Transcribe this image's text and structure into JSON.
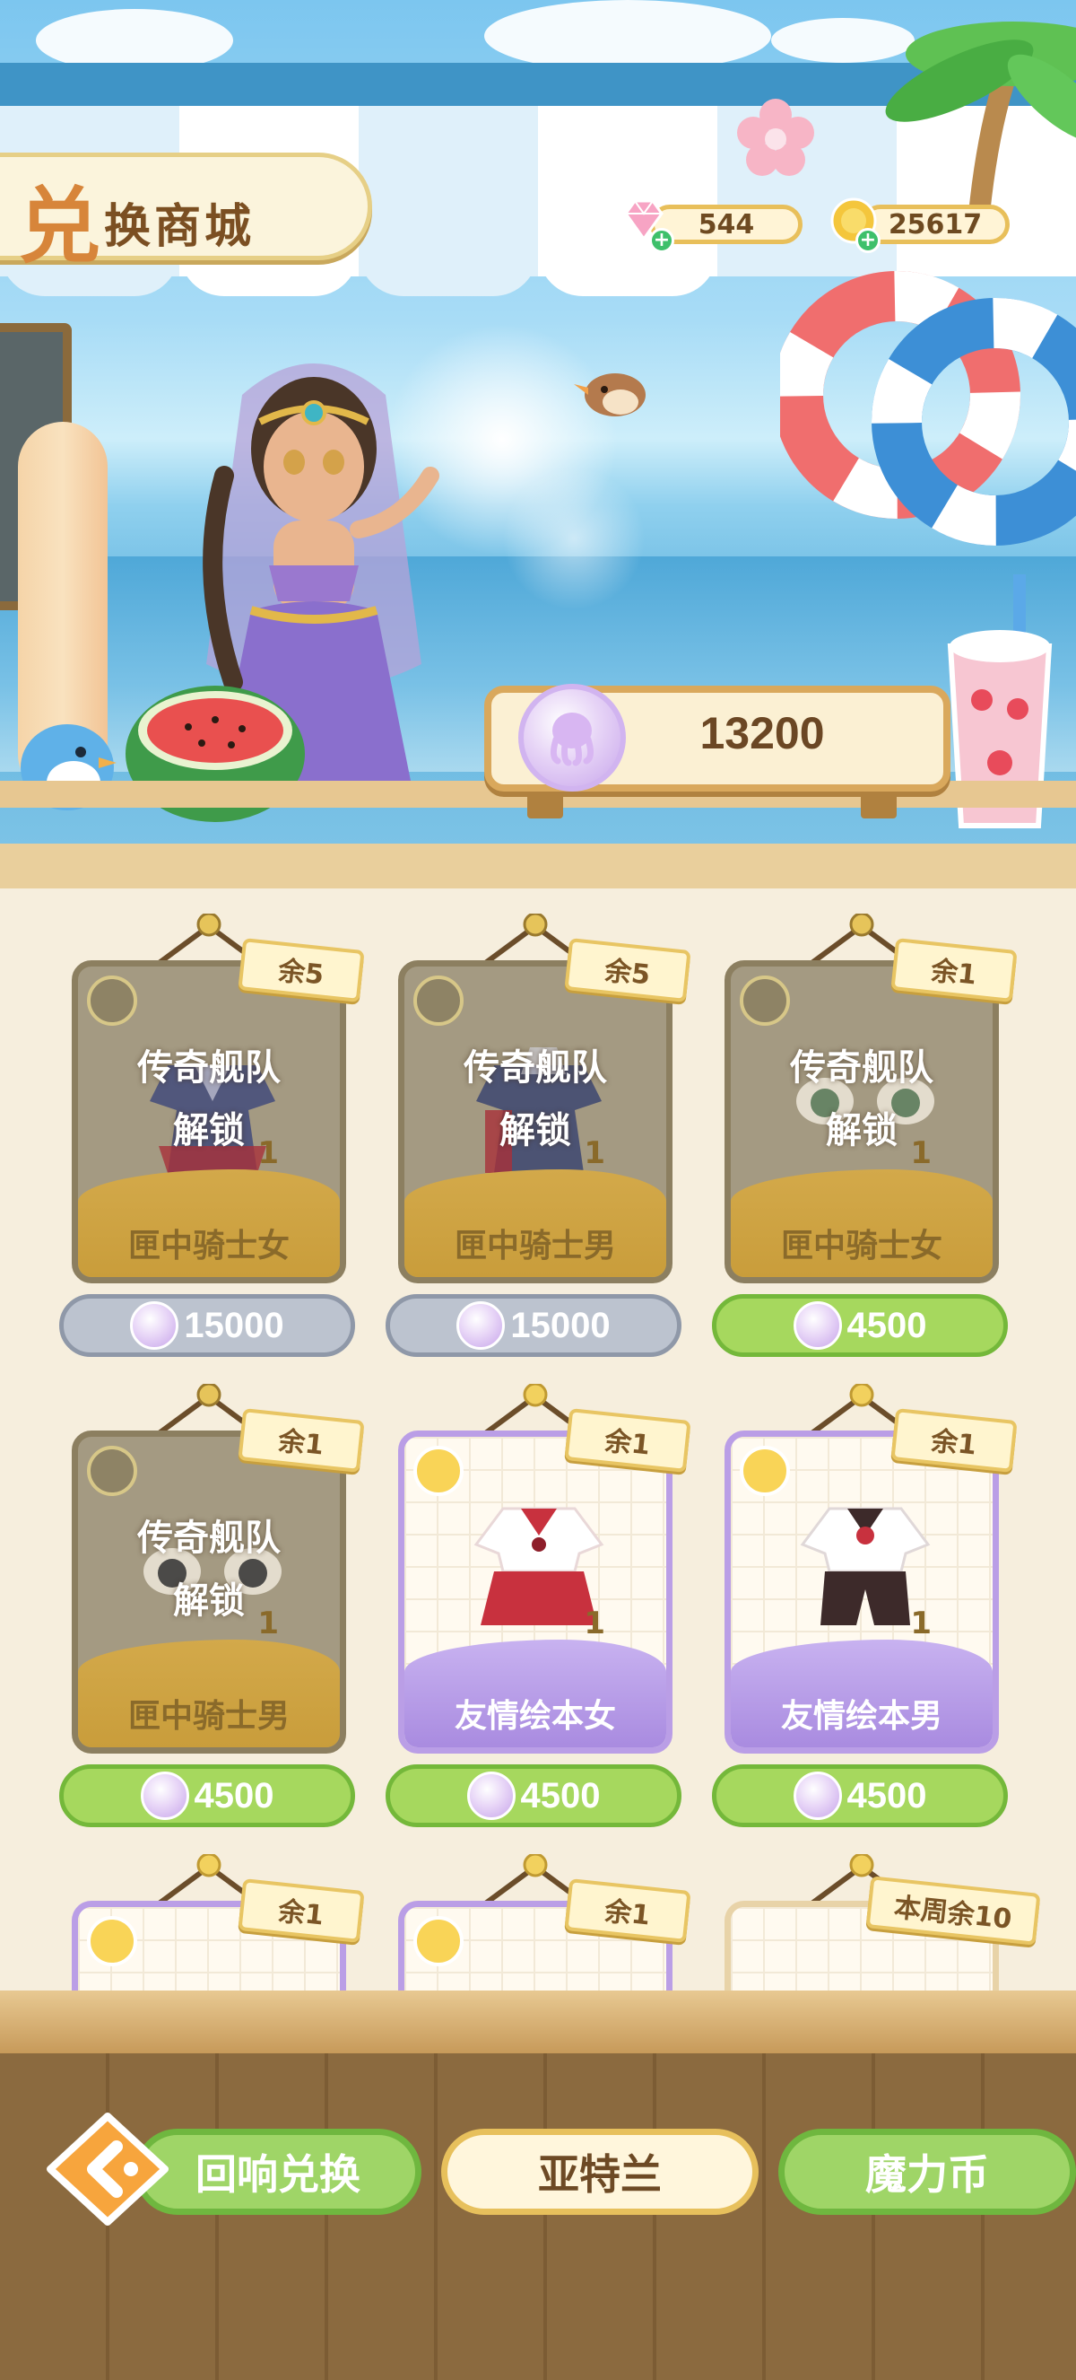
{
  "header": {
    "title_first_char": "兑",
    "title_rest": "换商城",
    "currency_gem": {
      "icon": "pink-diamond-icon",
      "value": "544"
    },
    "currency_gold": {
      "icon": "gold-coin-icon",
      "value": "25617"
    }
  },
  "balance": {
    "icon": "octopus-token-icon",
    "value": "13200"
  },
  "items": [
    {
      "stock": "余5",
      "locked": true,
      "lock_line1": "传奇舰队",
      "lock_line2": "解锁",
      "count": "1",
      "name": "匣中骑士女",
      "price": "15000",
      "price_style": "gray"
    },
    {
      "stock": "余5",
      "locked": true,
      "lock_line1": "传奇舰队",
      "lock_line2": "解锁",
      "count": "1",
      "name": "匣中骑士男",
      "price": "15000",
      "price_style": "gray"
    },
    {
      "stock": "余1",
      "locked": true,
      "lock_line1": "传奇舰队",
      "lock_line2": "解锁",
      "count": "1",
      "name": "匣中骑士女",
      "price": "4500",
      "price_style": "green"
    },
    {
      "stock": "余1",
      "locked": true,
      "lock_line1": "传奇舰队",
      "lock_line2": "解锁",
      "count": "1",
      "name": "匣中骑士男",
      "price": "4500",
      "price_style": "green"
    },
    {
      "stock": "余1",
      "locked": false,
      "count": "1",
      "name": "友情绘本女",
      "price": "4500",
      "price_style": "green"
    },
    {
      "stock": "余1",
      "locked": false,
      "count": "1",
      "name": "友情绘本男",
      "price": "4500",
      "price_style": "green"
    },
    {
      "stock": "余1",
      "partial": true
    },
    {
      "stock": "余1",
      "partial": true
    },
    {
      "stock": "本周余10",
      "partial": true
    }
  ],
  "tabs": {
    "tab1": "回响兑换",
    "tab2": "亚特兰",
    "tab3": "魔力币"
  },
  "colors": {
    "accent_green": "#9fd567",
    "accent_gold": "#e8c563",
    "locked_gray": "#a49a82"
  }
}
